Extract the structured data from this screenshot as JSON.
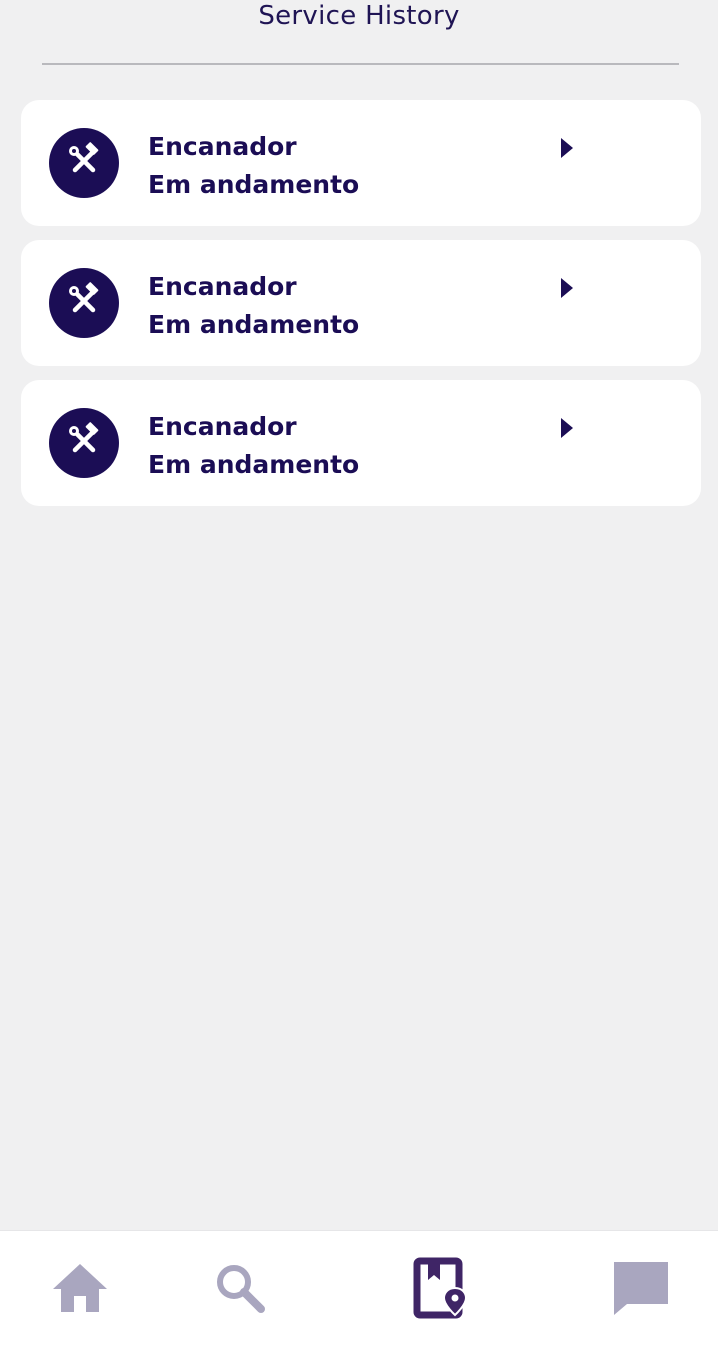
{
  "header": {
    "title": "Service History"
  },
  "services": [
    {
      "name": "Encanador",
      "status": "Em andamento",
      "icon": "tools-icon"
    },
    {
      "name": "Encanador",
      "status": "Em andamento",
      "icon": "tools-icon"
    },
    {
      "name": "Encanador",
      "status": "Em andamento",
      "icon": "tools-icon"
    }
  ],
  "bottom_nav": {
    "items": [
      {
        "icon": "home-icon",
        "active": false
      },
      {
        "icon": "search-icon",
        "active": false
      },
      {
        "icon": "service-history-icon",
        "active": true
      },
      {
        "icon": "chat-icon",
        "active": false
      }
    ]
  },
  "colors": {
    "primary": "#1b0d55",
    "inactive_icon": "#a9a6bf",
    "active_icon": "#3f2566",
    "background": "#f0f0f1",
    "card": "#ffffff"
  }
}
